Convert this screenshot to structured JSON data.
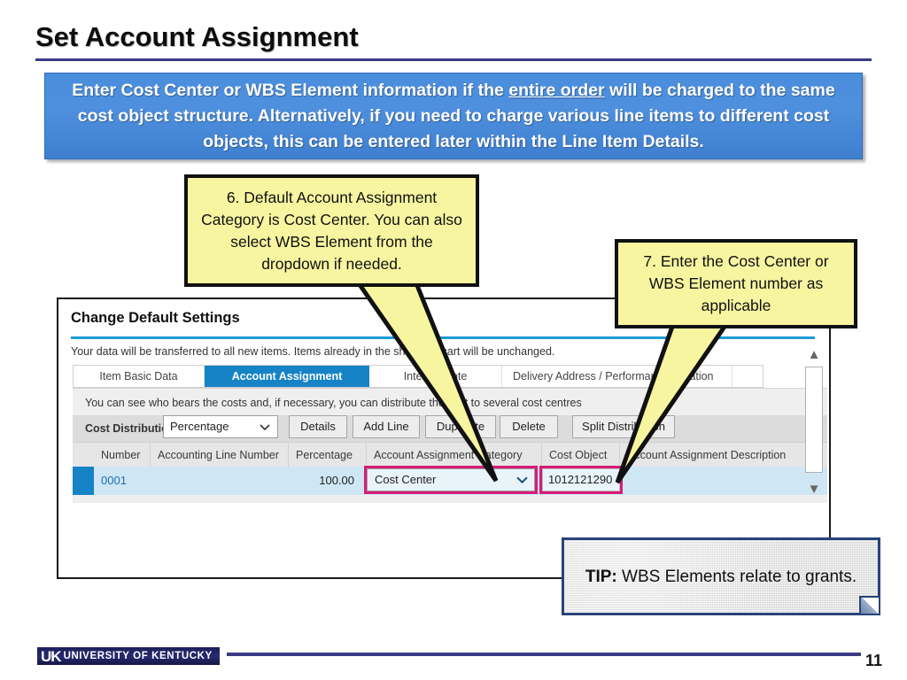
{
  "slide": {
    "title": "Set Account Assignment",
    "page_number": "11",
    "accent_blue": "#3a3a86",
    "banner_blue": "#4a8ddc",
    "highlight_magenta": "#d81b79"
  },
  "banner": {
    "text_before": "Enter Cost Center or WBS Element information if the ",
    "underlined": "entire order",
    "text_after": " will be charged to the same cost object structure. Alternatively, if you need to charge various line items to different cost objects, this can be entered later within the Line Item Details."
  },
  "callouts": [
    {
      "id": "6",
      "text": "6. Default Account Assignment Category is Cost Center. You can also select WBS Element from the dropdown if needed."
    },
    {
      "id": "7",
      "text": "7. Enter the Cost Center or WBS Element number as applicable"
    }
  ],
  "tip": {
    "label": "TIP:",
    "text": " WBS Elements relate to grants."
  },
  "app": {
    "title": "Change Default Settings",
    "note": "Your data will be transferred to all new items. Items already in the shopping cart will be unchanged.",
    "tabs": [
      {
        "label": "Item Basic Data",
        "active": false
      },
      {
        "label": "Account Assignment",
        "active": true
      },
      {
        "label": "Internal Note",
        "active": false
      },
      {
        "label": "Delivery Address / Performance Location",
        "active": false
      }
    ],
    "panel_note": "You can see who bears the costs and, if necessary, you can distribute the cost to several cost centres",
    "cost_distribution_label": "Cost Distribution",
    "cost_distribution_value": "Percentage",
    "buttons": [
      "Details",
      "Add Line",
      "Duplicate",
      "Delete",
      "Split Distribution"
    ],
    "table": {
      "columns": [
        "Number",
        "Accounting Line Number",
        "Percentage",
        "Account Assignment Category",
        "Cost Object",
        "Account Assignment Description"
      ],
      "rows": [
        {
          "number": "0001",
          "accounting_line_number": "",
          "percentage": "100.00",
          "account_assignment_category": "Cost Center",
          "cost_object": "1012121290",
          "account_assignment_description": ""
        }
      ]
    }
  },
  "footer": {
    "logo_mark": "UK",
    "logo_name": "UNIVERSITY OF KENTUCKY"
  }
}
